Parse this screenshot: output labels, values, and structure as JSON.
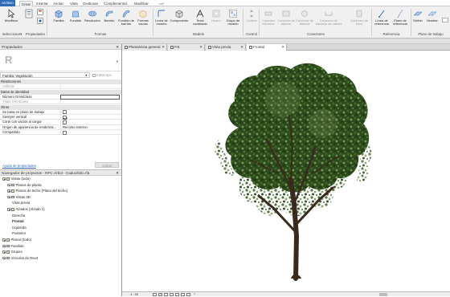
{
  "ribbon_tabs": [
    "Archivo",
    "Crear",
    "Insertar",
    "Anotar",
    "Vista",
    "Gestionar",
    "Complementos",
    "Modificar"
  ],
  "ribbon_extra": "▭•",
  "ribbon": {
    "modify_label": "Modificar",
    "select_label": "Seleccionar",
    "select_arrow": "▾",
    "buttons": [
      {
        "label": "Familia"
      },
      {
        "label": "Fundido"
      },
      {
        "label": "Revolución"
      },
      {
        "label": "Barrido"
      },
      {
        "label": "Fundido de barrido"
      },
      {
        "label": "Formas vacías"
      },
      {
        "label": "Línea de modelo"
      },
      {
        "label": "Componente"
      },
      {
        "label": "Texto modelado"
      },
      {
        "label": "Hueco"
      },
      {
        "label": "Grupo de modelo"
      },
      {
        "label": "Control"
      },
      {
        "label": "Conector eléctrico"
      },
      {
        "label": "Conector de tubería"
      },
      {
        "label": "Conector de tubería"
      },
      {
        "label": "Conector de bandeja de cables"
      },
      {
        "label": "Conector de tubo"
      },
      {
        "label": "Línea de referencia"
      },
      {
        "label": "Plano de referencia"
      },
      {
        "label": "Definir"
      },
      {
        "label": "Mostrar"
      }
    ],
    "groups": [
      "Seleccionar",
      "Propiedades",
      "Formas",
      "Modelo",
      "Control",
      "Conectores",
      "Referencia",
      "Plano de trabajo"
    ],
    "group_arrow": "▾"
  },
  "properties": {
    "title": "Propiedades",
    "close": "✕",
    "logo_letter": "R",
    "type_selector": "Familia: Vegetación",
    "edit_type": "Editar tipo",
    "rows": [
      {
        "cat": true,
        "key": "Restricciones"
      },
      {
        "key": "Anfitrión",
        "val": "",
        "muted": true
      },
      {
        "cat": true,
        "key": "Datos de identidad"
      },
      {
        "key": "Número OmniClass",
        "val": "",
        "box": true
      },
      {
        "key": "Título OmniClass",
        "val": "",
        "muted": true
      },
      {
        "cat": true,
        "key": "Otros"
      },
      {
        "key": "Se basa en plano de trabajo",
        "check": false
      },
      {
        "key": "Siempre vertical",
        "check": true
      },
      {
        "key": "Corte con vacíos al cargar",
        "check": false
      },
      {
        "key": "Origen de apariencia de renderiza...",
        "val": "Recurso externo"
      },
      {
        "key": "Compartido",
        "check": false
      }
    ],
    "help_link": "Ayuda de propiedades",
    "apply_button": "Aplicar"
  },
  "browser": {
    "title": "Navegador de proyectos - RPC Árbol - Caducifolio.rfa",
    "nodes": [
      {
        "label": "Vistas (todo)",
        "level": 0,
        "expanded": true
      },
      {
        "label": "Planos de planta",
        "level": 1
      },
      {
        "label": "Planos de techo (Plano del techo)",
        "level": 1
      },
      {
        "label": "Vistas 3D",
        "level": 1,
        "expanded": true
      },
      {
        "label": "Vista previa",
        "level": 2
      },
      {
        "label": "Alzados (Alzado 1)",
        "level": 1,
        "expanded": true
      },
      {
        "label": "Derecha",
        "level": 2
      },
      {
        "label": "Frontal",
        "level": 2,
        "bold": true
      },
      {
        "label": "Izquierda",
        "level": 2
      },
      {
        "label": "Posterior",
        "level": 2
      },
      {
        "label": "Planos (todo)",
        "level": 0
      },
      {
        "label": "Familias",
        "level": 0
      },
      {
        "label": "Grupos",
        "level": 0
      },
      {
        "label": "Vínculos de Revit",
        "level": 0
      }
    ]
  },
  "view_tabs": [
    {
      "label": "Planta/vista general"
    },
    {
      "label": "P.E"
    },
    {
      "label": "Vista previa"
    },
    {
      "label": "Frontal",
      "active": true
    }
  ],
  "tab_close": "✕",
  "status": {
    "scale": "1 : 20",
    "extra": "⁹"
  },
  "colors": {
    "file_tab": "#2f6bb5",
    "ribbon_bg": "#f0f0f0",
    "canopy_dark": "#1f3a14",
    "canopy_mid": "#3d6326",
    "canopy_light": "#7b9a5a",
    "trunk": "#3a2a1e"
  }
}
